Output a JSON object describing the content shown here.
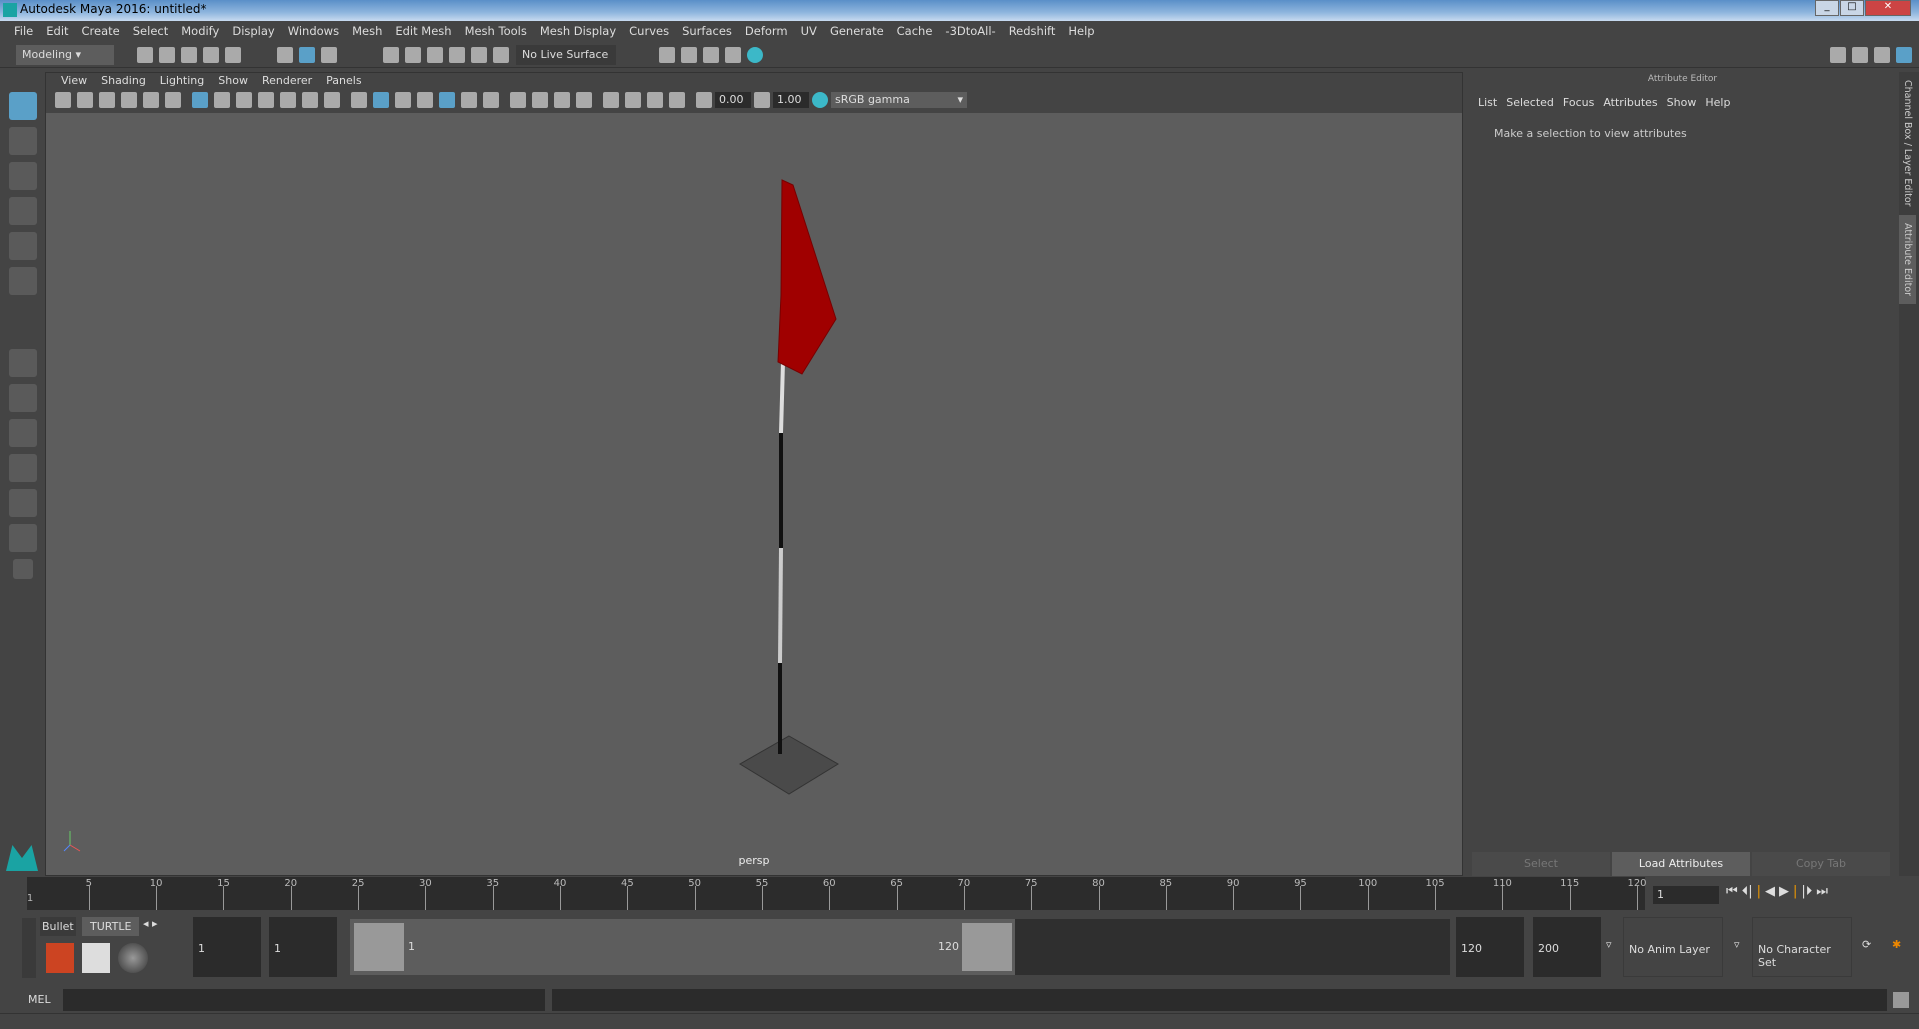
{
  "window": {
    "title": "Autodesk Maya 2016: untitled*"
  },
  "menubar": [
    "File",
    "Edit",
    "Create",
    "Select",
    "Modify",
    "Display",
    "Windows",
    "Mesh",
    "Edit Mesh",
    "Mesh Tools",
    "Mesh Display",
    "Curves",
    "Surfaces",
    "Deform",
    "UV",
    "Generate",
    "Cache",
    "-3DtoAll-",
    "Redshift",
    "Help"
  ],
  "shelf": {
    "mode": "Modeling",
    "live_surface": "No Live Surface"
  },
  "panel": {
    "menu": [
      "View",
      "Shading",
      "Lighting",
      "Show",
      "Renderer",
      "Panels"
    ],
    "exposure": "0.00",
    "gamma": "1.00",
    "color_space": "sRGB gamma",
    "camera": "persp"
  },
  "attribute_editor": {
    "title": "Attribute Editor",
    "menu": [
      "List",
      "Selected",
      "Focus",
      "Attributes",
      "Show",
      "Help"
    ],
    "message": "Make a selection to view attributes",
    "buttons": [
      "Select",
      "Load Attributes",
      "Copy Tab"
    ]
  },
  "side_tabs": [
    "Channel Box / Layer Editor",
    "Attribute Editor"
  ],
  "timeline": {
    "ticks": [
      "5",
      "10",
      "15",
      "20",
      "25",
      "30",
      "35",
      "40",
      "45",
      "50",
      "55",
      "60",
      "65",
      "70",
      "75",
      "80",
      "85",
      "90",
      "95",
      "100",
      "105",
      "110",
      "115",
      "120"
    ],
    "start_label": "1",
    "current_frame": "1"
  },
  "range": {
    "shelf_tabs": [
      "Bullet",
      "TURTLE"
    ],
    "start": "1",
    "playback_start": "1",
    "slider_start": "1",
    "slider_end": "120",
    "playback_end": "120",
    "end": "200",
    "anim_layer": "No Anim Layer",
    "character_set": "No Character Set"
  },
  "command": {
    "label": "MEL"
  },
  "colors": {
    "flag": "#a00000",
    "viewport": "#5d5d5d",
    "accent": "#5aa0c8"
  }
}
